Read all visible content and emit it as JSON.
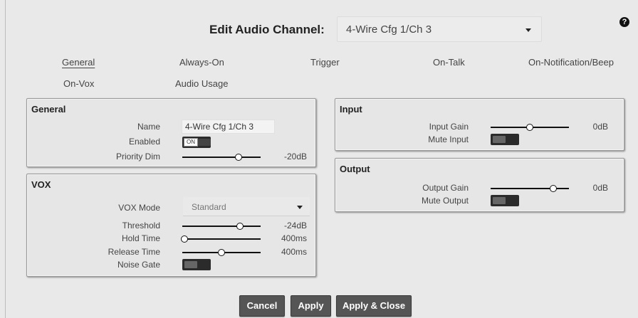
{
  "header": {
    "title": "Edit Audio Channel:",
    "selected_channel": "4-Wire Cfg 1/Ch 3",
    "help": "?"
  },
  "tabs": [
    "General",
    "Always-On",
    "Trigger",
    "On-Talk",
    "On-Notification/Beep",
    "On-Vox",
    "Audio Usage"
  ],
  "general": {
    "title": "General",
    "name_label": "Name",
    "name_value": "4-Wire Cfg 1/Ch 3",
    "enabled_label": "Enabled",
    "enabled_toggle_text": "ON",
    "priority_dim_label": "Priority Dim",
    "priority_dim_value": "-20dB",
    "priority_dim_level": 0.72
  },
  "vox": {
    "title": "VOX",
    "mode_label": "VOX Mode",
    "mode_value": "Standard",
    "threshold_label": "Threshold",
    "threshold_value": "-24dB",
    "threshold_level": 0.74,
    "hold_label": "Hold Time",
    "hold_value": "400ms",
    "hold_level": 0.03,
    "release_label": "Release Time",
    "release_value": "400ms",
    "release_level": 0.5,
    "noise_gate_label": "Noise Gate"
  },
  "input": {
    "title": "Input",
    "gain_label": "Input Gain",
    "gain_value": "0dB",
    "gain_level": 0.5,
    "mute_label": "Mute Input"
  },
  "output": {
    "title": "Output",
    "gain_label": "Output Gain",
    "gain_value": "0dB",
    "gain_level": 0.8,
    "mute_label": "Mute Output"
  },
  "buttons": {
    "cancel": "Cancel",
    "apply": "Apply",
    "apply_close": "Apply & Close"
  }
}
